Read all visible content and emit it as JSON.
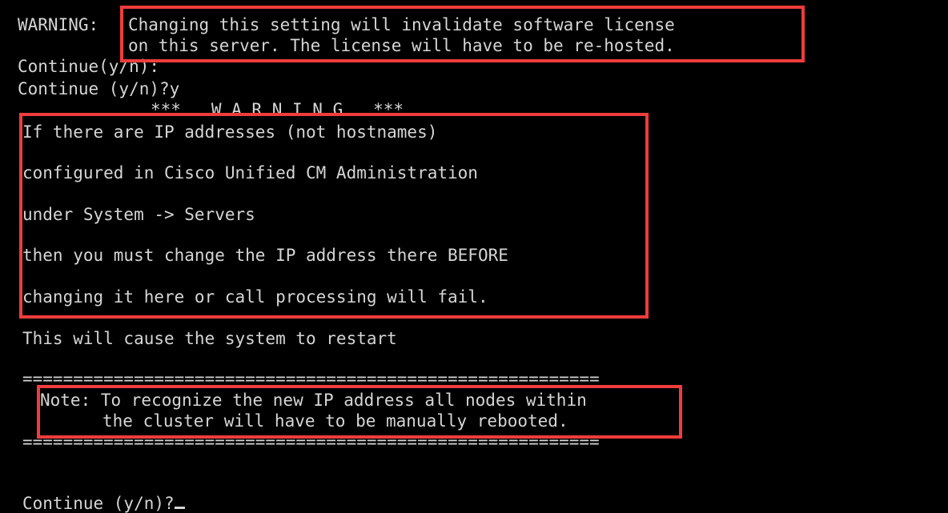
{
  "terminal": {
    "background_color": "#000000",
    "text_color": "#d5d5d5",
    "highlight_color": "#f03c3c",
    "lines": {
      "l1_label": "WARNING:",
      "l1_text": "Changing this setting will invalidate software license",
      "l2_text": "on this server. The license will have to be re-hosted.",
      "l3": "Continue(y/n):",
      "l4": "Continue (y/n)?y",
      "l5": "***   W A R N I N G   ***",
      "l6": "If there are IP addresses (not hostnames)",
      "l7": "configured in Cisco Unified CM Administration",
      "l8": "under System -> Servers",
      "l9": "then you must change the IP address there BEFORE",
      "l10": "changing it here or call processing will fail.",
      "l11": "This will cause the system to restart",
      "l12_separator": "=========================================================",
      "l13": "Note: To recognize the new IP address all nodes within",
      "l14": "the cluster will have to be manually rebooted.",
      "l15_separator": "=========================================================",
      "l16_prompt": "Continue (y/n)?"
    }
  },
  "highlights": [
    {
      "name": "license-warning-box",
      "note": "red annotation around license warning text"
    },
    {
      "name": "ip-address-warning-box",
      "note": "red annotation around IP address warning block"
    },
    {
      "name": "cluster-reboot-note-box",
      "note": "red annotation around cluster reboot note"
    }
  ]
}
